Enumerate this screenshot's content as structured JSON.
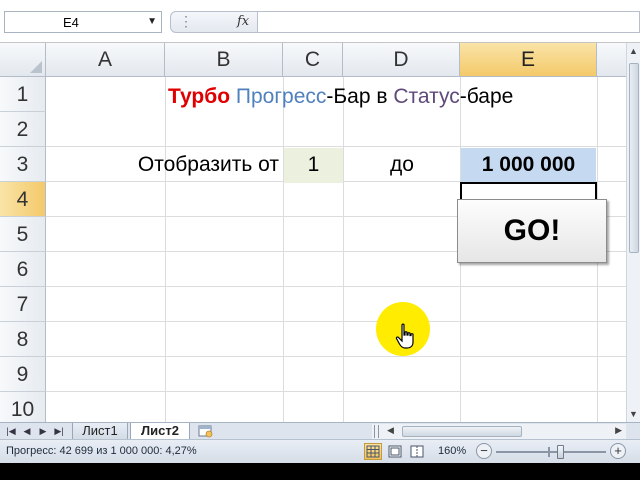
{
  "formula_bar": {
    "name_box": "E4",
    "fx_label": "fx",
    "formula": ""
  },
  "columns": [
    "A",
    "B",
    "C",
    "D",
    "E"
  ],
  "selected_column": "E",
  "rows": [
    "1",
    "2",
    "3",
    "4",
    "5",
    "6",
    "7",
    "8",
    "9",
    "10"
  ],
  "selected_row": "4",
  "cells": {
    "title_part1": "Турбо",
    "title_part2": "Прогресс",
    "title_part3": "-Бар в ",
    "title_part4": "Статус",
    "title_part5": "-баре",
    "b3_label": "Отобразить от",
    "c3_value": "1",
    "d3_label": "до",
    "e3_value": "1 000 000"
  },
  "go_button_label": "GO!",
  "sheet_tabs": [
    "Лист1",
    "Лист2"
  ],
  "active_sheet": "Лист2",
  "status": {
    "text": "Прогресс:  42 699 из 1 000 000: 4,27%",
    "zoom": "160%"
  },
  "colors": {
    "title_red": "#e00000",
    "title_blue": "#4f81bd",
    "title_purple": "#5f497a",
    "c3_fill": "#ebf1de",
    "e3_fill": "#c5d9f1",
    "selected_header": "#f4c96a",
    "cursor_highlight": "#ffec00"
  },
  "icons": {
    "name_box_dropdown": "chevron-down-icon",
    "function": "fx-icon",
    "cursor": "hand-pointer-icon",
    "new_sheet": "new-sheet-icon"
  }
}
